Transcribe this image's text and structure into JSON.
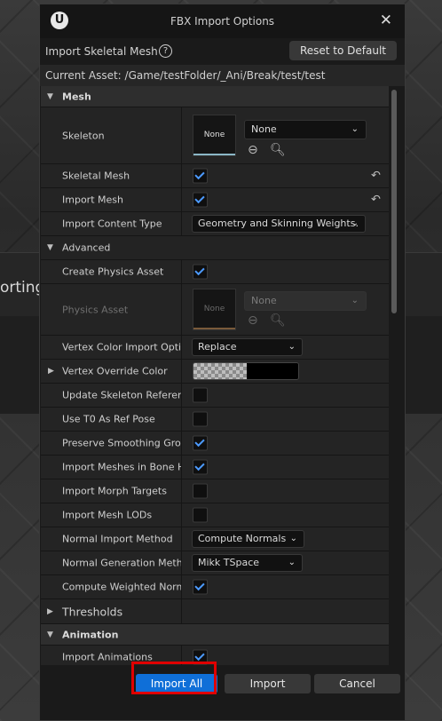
{
  "background": {
    "cut_text": "orting"
  },
  "dialog": {
    "logo": "U",
    "title": "FBX Import Options",
    "close_glyph": "✕",
    "header_label": "Import Skeletal Mesh",
    "help_glyph": "?",
    "reset_button": "Reset to Default",
    "current_asset": "Current Asset:  /Game/testFolder/_Ani/Break/test/test"
  },
  "mesh": {
    "section_label": "Mesh",
    "skeleton_label": "Skeleton",
    "skeleton_thumb": "None",
    "skeleton_value": "None",
    "skeletal_mesh_label": "Skeletal Mesh",
    "skeletal_mesh_checked": true,
    "import_mesh_label": "Import Mesh",
    "import_mesh_checked": true,
    "import_content_type_label": "Import Content Type",
    "import_content_type_value": "Geometry and Skinning Weights."
  },
  "advanced": {
    "label": "Advanced",
    "create_physics_label": "Create Physics Asset",
    "create_physics_checked": true,
    "physics_asset_label": "Physics Asset",
    "physics_asset_thumb": "None",
    "physics_asset_value": "None",
    "vertex_color_import_label": "Vertex Color Import Option",
    "vertex_color_import_value": "Replace",
    "vertex_override_label": "Vertex Override Color",
    "update_skeleton_label": "Update Skeleton Reference Pose",
    "use_t0_label": "Use T0 As Ref Pose",
    "preserve_smoothing_label": "Preserve Smoothing Groups",
    "import_meshes_in_bone_label": "Import Meshes in Bone Hierarchy",
    "import_morph_label": "Import Morph Targets",
    "import_lods_label": "Import Mesh LODs",
    "normal_import_method_label": "Normal Import Method",
    "normal_import_method_value": "Compute Normals",
    "normal_generation_label": "Normal Generation Method",
    "normal_generation_value": "Mikk TSpace",
    "compute_weighted_label": "Compute Weighted Normals",
    "thresholds_label": "Thresholds"
  },
  "animation": {
    "section_label": "Animation",
    "import_animations_label": "Import Animations"
  },
  "footer": {
    "import_all": "Import All",
    "import": "Import",
    "cancel": "Cancel"
  },
  "colors": {
    "accent": "#0f6fd8",
    "highlight": "#e00000",
    "check": "#4c9aff"
  }
}
